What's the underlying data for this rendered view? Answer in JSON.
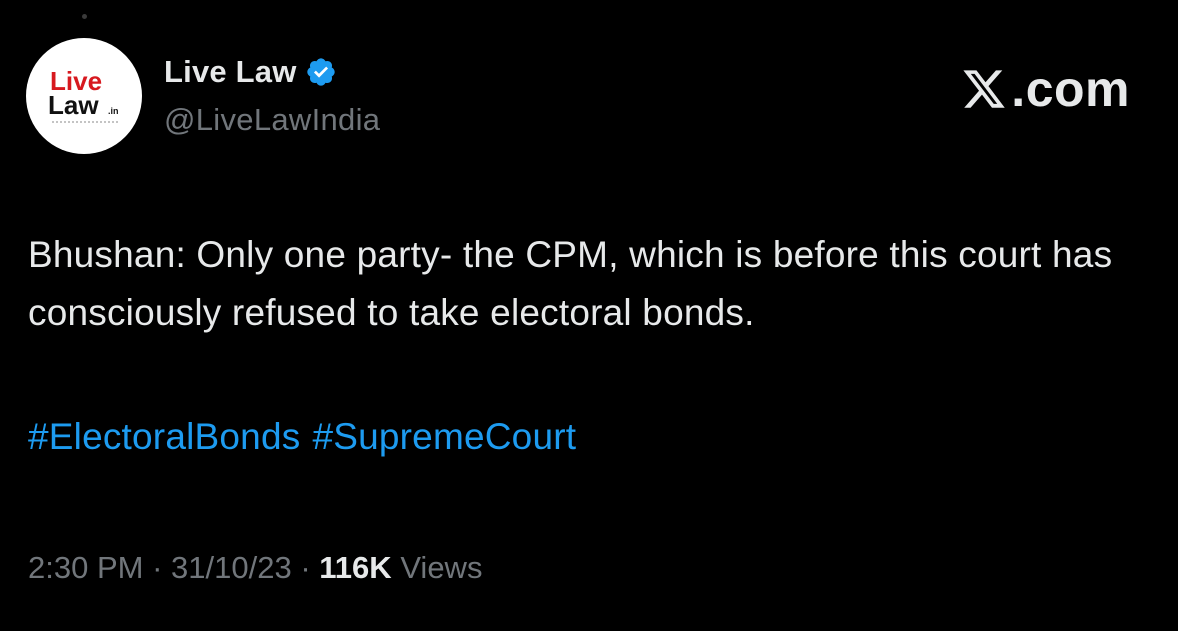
{
  "author": {
    "display_name": "Live Law",
    "handle": "@LiveLawIndia",
    "verified_icon": "verified-badge-icon",
    "avatar_logo": {
      "line1": "Live",
      "line2": "Law",
      "suffix": ".in",
      "line1_color": "#d7191f",
      "line2_color": "#111111"
    }
  },
  "brand": {
    "icon": "x-logo-icon",
    "text": ".com"
  },
  "tweet": {
    "text": "Bhushan: Only one party- the CPM, which is before this court has consciously refused to take electoral bonds.",
    "hashtags": [
      "#ElectoralBonds",
      "#SupremeCourt"
    ]
  },
  "meta": {
    "time": "2:30 PM",
    "separator": "·",
    "date": "31/10/23",
    "views_count": "116K",
    "views_label": "Views"
  },
  "colors": {
    "background": "#000000",
    "primary_text": "#e7e9ea",
    "secondary_text": "#71767b",
    "link": "#1d9bf0",
    "verified": "#1d9bf0"
  }
}
